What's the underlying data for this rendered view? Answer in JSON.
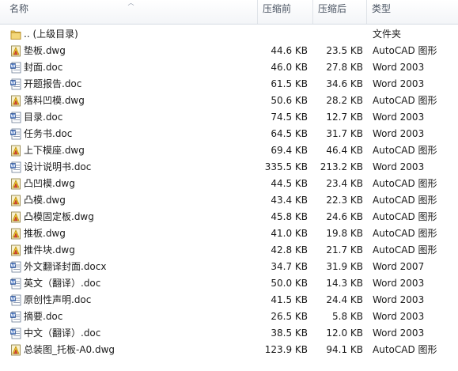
{
  "header": {
    "name": "名称",
    "size_before": "压缩前",
    "size_after": "压缩后",
    "type": "类型"
  },
  "colors": {
    "header_text": "#4b5563",
    "folder": "#e8c45a",
    "word_blue": "#2b5fb8",
    "cad_yellow": "#f2c230"
  },
  "files": [
    {
      "name": ".. (上级目录)",
      "before": "",
      "after": "",
      "type": "文件夹",
      "icon": "folder-icon"
    },
    {
      "name": "垫板.dwg",
      "before": "44.6 KB",
      "after": "23.5 KB",
      "type": "AutoCAD 图形",
      "icon": "autocad-icon"
    },
    {
      "name": "封面.doc",
      "before": "46.0 KB",
      "after": "27.8 KB",
      "type": "Word 2003",
      "icon": "word-icon"
    },
    {
      "name": "开题报告.doc",
      "before": "61.5 KB",
      "after": "34.6 KB",
      "type": "Word 2003",
      "icon": "word-icon"
    },
    {
      "name": "落料凹模.dwg",
      "before": "50.6 KB",
      "after": "28.2 KB",
      "type": "AutoCAD 图形",
      "icon": "autocad-icon"
    },
    {
      "name": "目录.doc",
      "before": "74.5 KB",
      "after": "12.7 KB",
      "type": "Word 2003",
      "icon": "word-icon"
    },
    {
      "name": "任务书.doc",
      "before": "64.5 KB",
      "after": "31.7 KB",
      "type": "Word 2003",
      "icon": "word-icon"
    },
    {
      "name": "上下模座.dwg",
      "before": "69.4 KB",
      "after": "46.4 KB",
      "type": "AutoCAD 图形",
      "icon": "autocad-icon"
    },
    {
      "name": "设计说明书.doc",
      "before": "335.5 KB",
      "after": "213.2 KB",
      "type": "Word 2003",
      "icon": "word-icon"
    },
    {
      "name": "凸凹模.dwg",
      "before": "44.5 KB",
      "after": "23.4 KB",
      "type": "AutoCAD 图形",
      "icon": "autocad-icon"
    },
    {
      "name": "凸模.dwg",
      "before": "43.4 KB",
      "after": "22.3 KB",
      "type": "AutoCAD 图形",
      "icon": "autocad-icon"
    },
    {
      "name": "凸模固定板.dwg",
      "before": "45.8 KB",
      "after": "24.6 KB",
      "type": "AutoCAD 图形",
      "icon": "autocad-icon"
    },
    {
      "name": "推板.dwg",
      "before": "41.0 KB",
      "after": "19.8 KB",
      "type": "AutoCAD 图形",
      "icon": "autocad-icon"
    },
    {
      "name": "推件块.dwg",
      "before": "42.8 KB",
      "after": "21.7 KB",
      "type": "AutoCAD 图形",
      "icon": "autocad-icon"
    },
    {
      "name": "外文翻译封面.docx",
      "before": "34.7 KB",
      "after": "31.9 KB",
      "type": "Word 2007",
      "icon": "word-icon"
    },
    {
      "name": "英文（翻译）.doc",
      "before": "50.0 KB",
      "after": "14.3 KB",
      "type": "Word 2003",
      "icon": "word-icon"
    },
    {
      "name": "原创性声明.doc",
      "before": "41.5 KB",
      "after": "24.4 KB",
      "type": "Word 2003",
      "icon": "word-icon"
    },
    {
      "name": "摘要.doc",
      "before": "26.5 KB",
      "after": "5.8 KB",
      "type": "Word 2003",
      "icon": "word-icon"
    },
    {
      "name": "中文（翻译）.doc",
      "before": "38.5 KB",
      "after": "12.0 KB",
      "type": "Word 2003",
      "icon": "word-icon"
    },
    {
      "name": "总装图_托板-A0.dwg",
      "before": "123.9 KB",
      "after": "94.1 KB",
      "type": "AutoCAD 图形",
      "icon": "autocad-icon"
    }
  ]
}
